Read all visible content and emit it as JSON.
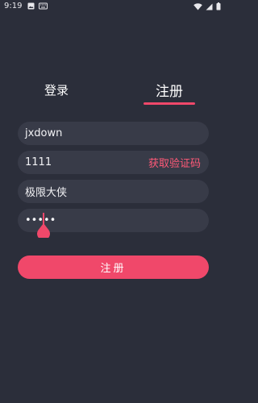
{
  "status_bar": {
    "time": "9:19",
    "left_icons": [
      "image-icon",
      "keyboard-icon"
    ],
    "right_icons": [
      "wifi-icon",
      "cellular-icon",
      "battery-icon"
    ]
  },
  "tabs": {
    "login_label": "登录",
    "register_label": "注册",
    "active": "register"
  },
  "form": {
    "username_value": "jxdown",
    "phone_value": "1111",
    "get_code_label": "获取验证码",
    "nickname_value": "极限大侠",
    "password_mask": "•••••"
  },
  "submit": {
    "label": "注册"
  },
  "colors": {
    "background": "#2b2e3a",
    "field_background": "#383b48",
    "accent": "#f0486a",
    "code_text": "#ff5a78"
  }
}
